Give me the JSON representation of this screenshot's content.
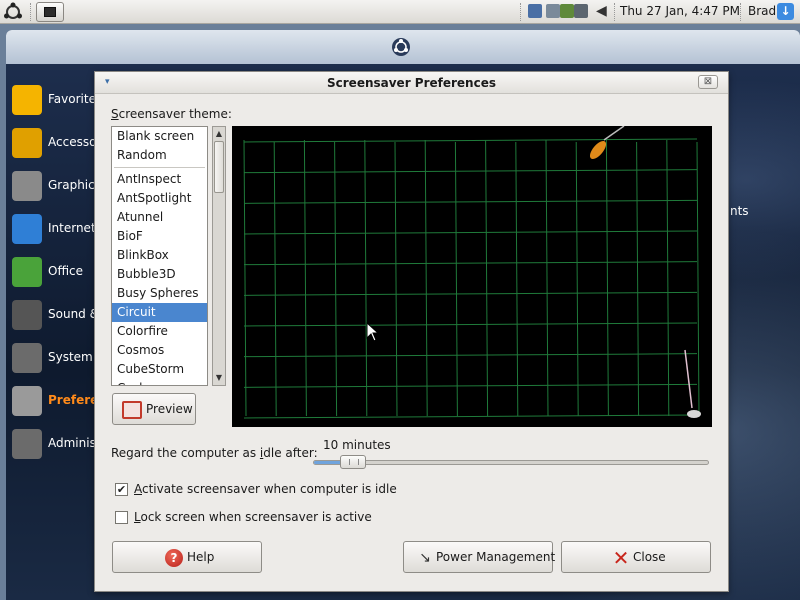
{
  "top_panel": {
    "clock": "Thu 27 Jan,  4:47 PM",
    "user": "Brad",
    "update_glyph": "↓"
  },
  "menu": {
    "categories": [
      {
        "label": "Favorites",
        "icon": "star-icon",
        "color": "#f5b400"
      },
      {
        "label": "Accessories",
        "icon": "drill-icon",
        "color": "#e0a000"
      },
      {
        "label": "Graphics",
        "icon": "brush-icon",
        "color": "#8a8a8a"
      },
      {
        "label": "Internet",
        "icon": "globe-icon",
        "color": "#2f7fd6"
      },
      {
        "label": "Office",
        "icon": "books-icon",
        "color": "#4aa33a"
      },
      {
        "label": "Sound & Video",
        "icon": "film-icon",
        "color": "#555555"
      },
      {
        "label": "System",
        "icon": "system-icon",
        "color": "#6b6b6b"
      },
      {
        "label": "Preferences",
        "icon": "tools-icon",
        "color": "#9a9a9a"
      },
      {
        "label": "Administration",
        "icon": "admin-icon",
        "color": "#6b6b6b"
      }
    ],
    "right_text": "nts"
  },
  "dialog": {
    "title": "Screensaver Preferences",
    "theme_label_underline": "S",
    "theme_label_rest": "creensaver theme:",
    "themes_top": [
      "Blank screen",
      "Random"
    ],
    "themes": [
      "AntInspect",
      "AntSpotlight",
      "Atunnel",
      "BioF",
      "BlinkBox",
      "Bubble3D",
      "Busy Spheres",
      "Circuit",
      "Colorfire",
      "Cosmos",
      "CubeStorm",
      "Cyclone"
    ],
    "selected_theme": "Circuit",
    "preview_button": "Preview",
    "idle_label_pre": "Regard the computer as ",
    "idle_label_underline": "i",
    "idle_label_post": "dle after:",
    "idle_value": "10 minutes",
    "idle_fraction": 0.1,
    "activate_checkbox": {
      "checked": true,
      "mark": "✔",
      "underline": "A",
      "rest": "ctivate screensaver when computer is idle"
    },
    "lock_checkbox": {
      "checked": false,
      "mark": "",
      "underline": "L",
      "rest": "ock screen when screensaver is active"
    },
    "help_button": "Help",
    "power_button": "Power Management",
    "close_button": "Close",
    "help_glyph": "?",
    "close_glyph": "✕",
    "power_glyph": "↘",
    "title_close_glyph": "⊠",
    "title_menu_glyph": "▾"
  },
  "colors": {
    "selection": "#4a86cf",
    "circuit_grid": "#1f7a3a",
    "accent_orange": "#ff8a1a"
  }
}
